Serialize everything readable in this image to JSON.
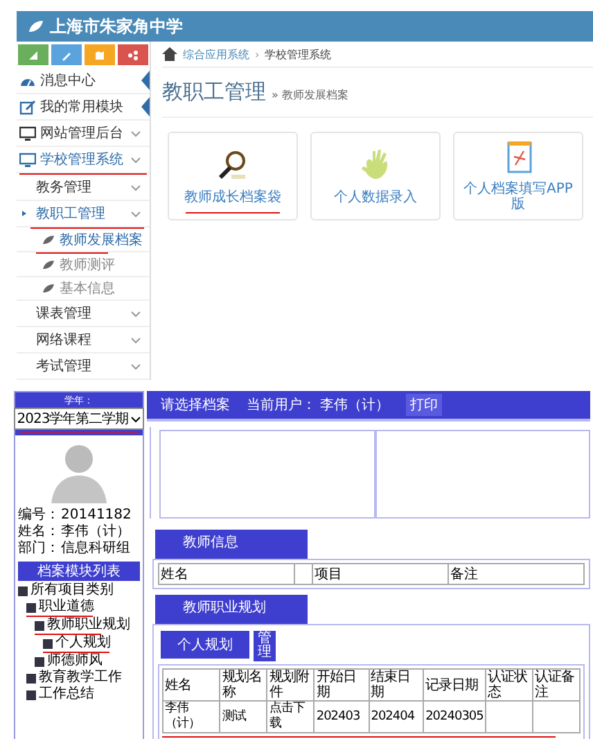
{
  "portal": {
    "school_name": "上海市朱家角中学",
    "toolbar": [
      {
        "color": "#6aaf5c"
      },
      {
        "color": "#5aa3dc"
      },
      {
        "color": "#f5a623"
      },
      {
        "color": "#d9534f"
      }
    ],
    "menu": [
      {
        "label": "消息中心",
        "kind": "link",
        "selected": false,
        "underlined": false
      },
      {
        "label": "我的常用模块",
        "kind": "link",
        "selected": false,
        "underlined": false
      },
      {
        "label": "网站管理后台",
        "kind": "group",
        "selected": false,
        "underlined": false
      },
      {
        "label": "学校管理系统",
        "kind": "group",
        "selected": true,
        "underlined": true,
        "children": [
          {
            "label": "教务管理",
            "kind": "group",
            "selected": false,
            "underlined": false
          },
          {
            "label": "教职工管理",
            "kind": "group",
            "selected": true,
            "underlined": true,
            "children": [
              {
                "label": "教师发展档案",
                "kind": "leaf",
                "selected": true,
                "underlined": true
              },
              {
                "label": "教师测评",
                "kind": "leaf",
                "selected": false,
                "underlined": false
              },
              {
                "label": "基本信息",
                "kind": "leaf",
                "selected": false,
                "underlined": false
              }
            ]
          },
          {
            "label": "课表管理",
            "kind": "group",
            "selected": false,
            "underlined": false
          },
          {
            "label": "网络课程",
            "kind": "group",
            "selected": false,
            "underlined": false
          },
          {
            "label": "考试管理",
            "kind": "group",
            "selected": false,
            "underlined": false
          }
        ]
      }
    ],
    "breadcrumb": [
      "综合应用系统",
      "学校管理系统"
    ],
    "breadcrumb_separator": "›",
    "page_title": "教职工管理",
    "page_subtitle": "» 教师发展档案",
    "cards": [
      {
        "label": "教师成长档案袋",
        "kind": "magnifier",
        "underlined": true
      },
      {
        "label": "个人数据录入",
        "kind": "hand",
        "underlined": false
      },
      {
        "label": "个人档案填写APP版",
        "kind": "clipboard",
        "underlined": false
      }
    ]
  },
  "archive": {
    "term_label": "学年：",
    "term_select": "2023学年第二学期",
    "profile": [
      {
        "label": "编号：",
        "value": "20141182"
      },
      {
        "label": "姓名：",
        "value": "李伟（计）"
      },
      {
        "label": "部门：",
        "value": "信息科研组"
      }
    ],
    "tree_title": "档案模块列表",
    "tree": [
      {
        "label": "所有项目类别",
        "underlined": false,
        "children": [
          {
            "label": "职业道德",
            "underlined": true,
            "children": [
              {
                "label": "教师职业规划",
                "underlined": true,
                "children": [
                  {
                    "label": "个人规划",
                    "underlined": true
                  }
                ]
              },
              {
                "label": "师德师风",
                "underlined": false
              }
            ]
          },
          {
            "label": "教育教学工作",
            "underlined": false
          },
          {
            "label": "工作总结",
            "underlined": false
          }
        ]
      }
    ],
    "header": {
      "title": "请选择档案",
      "user_label": "当前用户：",
      "user": "李伟（计）",
      "print_button": "打印"
    },
    "info_section": {
      "title": "教师信息",
      "cells": [
        "姓名",
        "",
        "项目",
        "备注"
      ]
    },
    "plan_section": {
      "title": "教师职业规划",
      "tab": "个人规划",
      "manage_button": "管理",
      "columns": [
        "姓名",
        "规划名称",
        "规划附件",
        "开始日期",
        "结束日期",
        "记录日期",
        "认证状态",
        "认证备注"
      ],
      "rows": [
        {
          "cells": [
            "李伟（计）",
            "测试",
            "点击下载",
            "202403",
            "202404",
            "20240305",
            "",
            ""
          ],
          "underlined": true
        }
      ]
    }
  }
}
